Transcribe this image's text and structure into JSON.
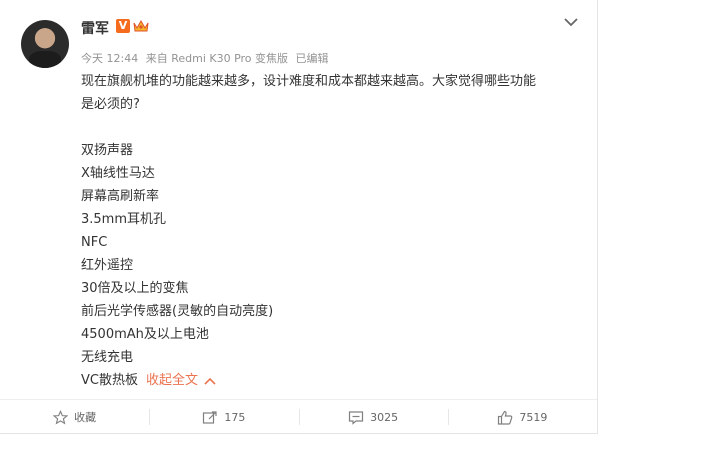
{
  "post": {
    "username": "雷军",
    "verified_badge": "V",
    "meta": {
      "time": "今天 12:44",
      "source": "来自 Redmi K30 Pro 变焦版",
      "edited": "已编辑"
    },
    "text_line1": "现在旗舰机堆的功能越来越多，设计难度和成本都越来越高。大家觉得哪些功能",
    "text_line2": "是必须的?",
    "items": [
      "双扬声器",
      "X轴线性马达",
      "屏幕高刷新率",
      "3.5mm耳机孔",
      "NFC",
      "红外遥控",
      "30倍及以上的变焦",
      "前后光学传感器(灵敏的自动亮度)",
      "4500mAh及以上电池",
      "无线充电",
      "VC散热板"
    ],
    "collapse_label": "收起全文"
  },
  "actions": {
    "favorite_label": "收藏",
    "repost_count": "175",
    "comment_count": "3025",
    "like_count": "7519"
  },
  "colors": {
    "accent": "#eb7350",
    "verified": "#f56c1e",
    "meta_gray": "#939393"
  },
  "icons": [
    "chevron-down-icon",
    "crown-icon",
    "star-icon",
    "repost-icon",
    "comment-icon",
    "thumbs-up-icon",
    "chevron-up-icon"
  ]
}
